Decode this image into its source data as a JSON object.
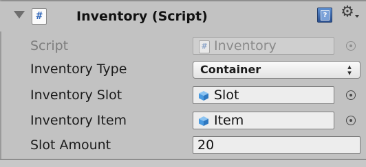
{
  "component": {
    "title": "Inventory (Script)"
  },
  "fields": {
    "script": {
      "label": "Script",
      "value": "Inventory"
    },
    "inventory_type": {
      "label": "Inventory Type",
      "value": "Container"
    },
    "inventory_slot": {
      "label": "Inventory Slot",
      "value": "Slot"
    },
    "inventory_item": {
      "label": "Inventory Item",
      "value": "Item"
    },
    "slot_amount": {
      "label": "Slot Amount",
      "value": "20"
    }
  },
  "icons": {
    "header": [
      "foldout-arrow-icon",
      "script-icon",
      "help-icon",
      "gear-icon"
    ],
    "object_field": "prefab-cube-icon",
    "picker": "object-picker-icon"
  },
  "colors": {
    "panel_bg": "#c2c2c2",
    "field_bg": "#ededed",
    "accent_blue": "#3a6ebd",
    "cube_blue": "#4a9ae0"
  }
}
